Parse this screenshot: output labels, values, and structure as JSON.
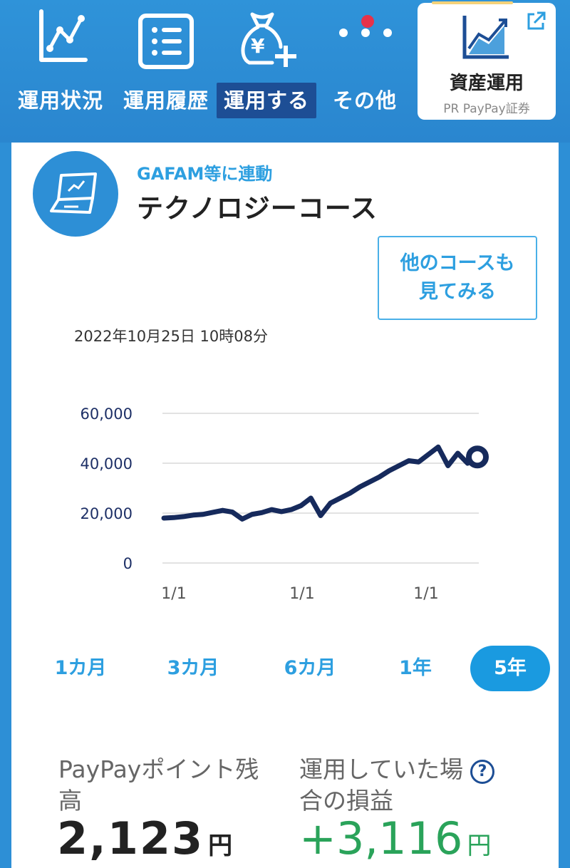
{
  "nav": {
    "items": [
      {
        "label": "運用状況",
        "icon": "line-chart-icon"
      },
      {
        "label": "運用履歴",
        "icon": "list-icon"
      },
      {
        "label": "運用する",
        "icon": "money-bag-plus-icon",
        "active": true
      },
      {
        "label": "その他",
        "icon": "more-dots-icon",
        "badge": true
      }
    ],
    "invest_card": {
      "title": "資産運用",
      "subtitle": "PR PayPay証券",
      "icon": "growth-chart-icon",
      "external_icon": "external-link-icon"
    }
  },
  "course": {
    "tag": "GAFAM等に連動",
    "name": "テクノロジーコース",
    "icon": "laptop-icon",
    "other_button_line1": "他のコースも",
    "other_button_line2": "見てみる"
  },
  "timestamp": "2022年10月25日 10時08分",
  "chart_data": {
    "type": "line",
    "ylim": [
      0,
      60000
    ],
    "yticks": [
      "60,000",
      "40,000",
      "20,000",
      "0"
    ],
    "xticks": [
      "1/1",
      "1/1",
      "1/1"
    ],
    "series": [
      {
        "values": [
          18000,
          18200,
          18600,
          19200,
          19500,
          20300,
          21100,
          20400,
          17600,
          19500,
          20200,
          21400,
          20600,
          21400,
          23000,
          26000,
          19000,
          24000,
          26000,
          28000,
          30500,
          32500,
          34500,
          37000,
          39000,
          41000,
          40500,
          43500,
          46500,
          39000,
          44000,
          40000,
          42500
        ]
      }
    ],
    "line_color": "#162a5c"
  },
  "periods": [
    {
      "label": "1カ月"
    },
    {
      "label": "3カ月"
    },
    {
      "label": "6カ月"
    },
    {
      "label": "1年"
    },
    {
      "label": "5年",
      "active": true
    }
  ],
  "summary": {
    "balance_label": "PayPayポイント残高",
    "balance_value": "2,123",
    "balance_unit": "円",
    "pl_label": "運用していた場合の損益",
    "pl_help": "?",
    "pl_value": "+3,116",
    "pl_unit": "円"
  }
}
